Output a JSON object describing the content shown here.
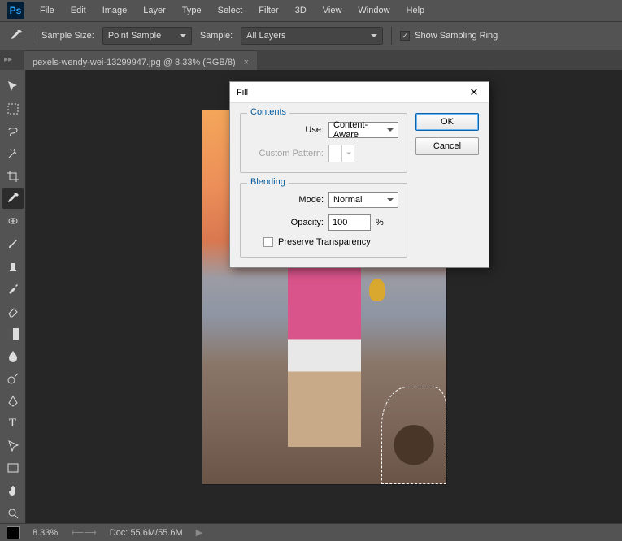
{
  "app": {
    "logo_text": "Ps"
  },
  "menubar": [
    "File",
    "Edit",
    "Image",
    "Layer",
    "Type",
    "Select",
    "Filter",
    "3D",
    "View",
    "Window",
    "Help"
  ],
  "options": {
    "sample_size_label": "Sample Size:",
    "sample_size_value": "Point Sample",
    "sample_label": "Sample:",
    "sample_value": "All Layers",
    "show_ring_label": "Show Sampling Ring",
    "show_ring_checked": true
  },
  "tab": {
    "title": "pexels-wendy-wei-13299947.jpg @ 8.33% (RGB/8)",
    "close": "×",
    "handle": "▸▸"
  },
  "tools": [
    "move",
    "marquee",
    "lasso",
    "wand",
    "crop",
    "eyedropper",
    "healing",
    "brush",
    "stamp",
    "history-brush",
    "eraser",
    "gradient",
    "blur",
    "dodge",
    "pen",
    "type",
    "path-select",
    "shape",
    "hand",
    "zoom"
  ],
  "active_tool": "eyedropper",
  "status": {
    "zoom": "8.33%",
    "doc_label": "Doc:",
    "doc_value": "55.6M/55.6M"
  },
  "dialog": {
    "title": "Fill",
    "close": "✕",
    "ok": "OK",
    "cancel": "Cancel",
    "contents_legend": "Contents",
    "use_label": "Use:",
    "use_value": "Content-Aware",
    "custom_pattern_label": "Custom Pattern:",
    "blending_legend": "Blending",
    "mode_label": "Mode:",
    "mode_value": "Normal",
    "opacity_label": "Opacity:",
    "opacity_value": "100",
    "opacity_unit": "%",
    "preserve_label": "Preserve Transparency"
  }
}
